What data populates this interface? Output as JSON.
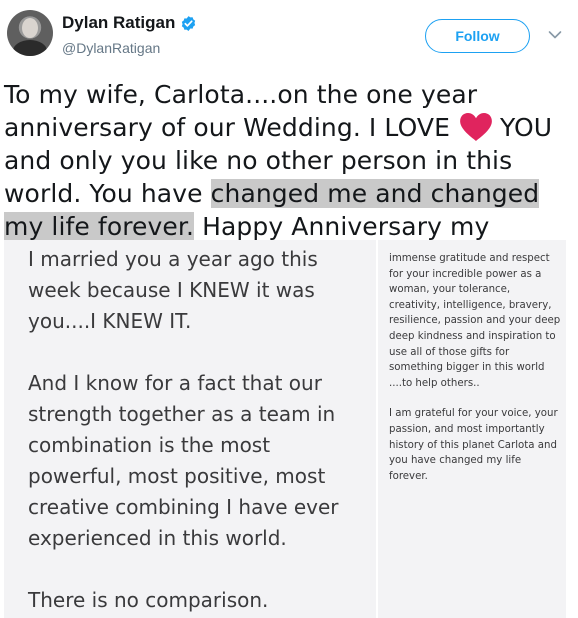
{
  "author": {
    "display_name": "Dylan Ratigan",
    "handle": "@DylanRatigan",
    "verified": true
  },
  "actions": {
    "follow_label": "Follow"
  },
  "colors": {
    "accent": "#1da1f2",
    "highlight": "#c9c9c9",
    "heart": "#e0245e"
  },
  "icons": [
    "verified-icon",
    "chevron-down-icon",
    "heart-icon"
  ],
  "tweet": {
    "part1": "To my wife, Carlota....on the one year anniversary of our Wedding. I LOVE",
    "part2": "YOU and only you like no other person in this world. You have",
    "highlighted": "changed me and changed my life forever.",
    "part3": "Happy Anniversary my love...."
  },
  "note_left": {
    "paragraphs": [
      "I married you a year ago this week because I KNEW it was you....I KNEW IT.",
      "And I know for a fact that our strength together as a team in combination is the most powerful, most positive, most creative combining I have ever experienced in this world.",
      "There is no comparison."
    ]
  },
  "note_right": {
    "paragraphs": [
      "immense gratitude and respect for your incredible power as a woman, your tolerance, creativity, intelligence, bravery, resilience, passion and your deep deep kindness and inspiration to use all of those gifts for something bigger in this world ....to help others..",
      "I am grateful for your voice, your passion, and most importantly history of this planet Carlota and you have changed my life forever."
    ]
  }
}
